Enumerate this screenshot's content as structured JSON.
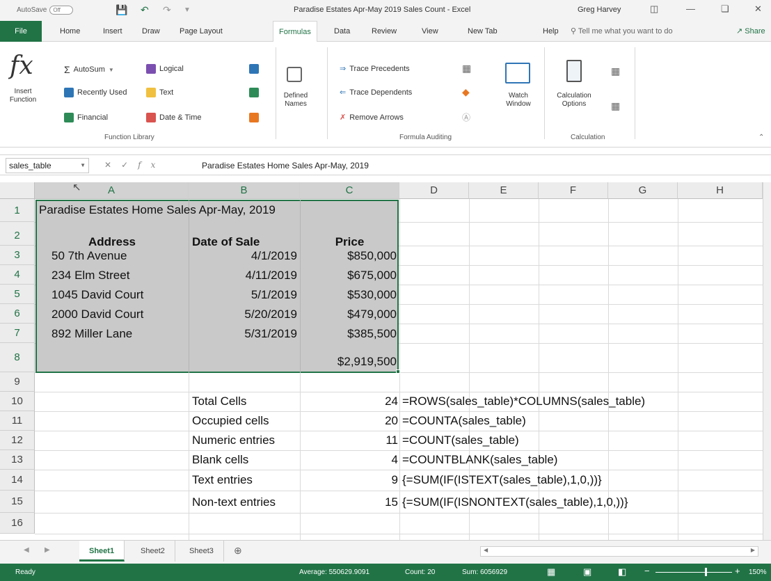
{
  "titlebar": {
    "autosave_label": "AutoSave",
    "autosave_state": "Off",
    "title": "Paradise Estates Apr-May 2019 Sales Count  -  Excel",
    "user": "Greg Harvey"
  },
  "tabs": [
    "File",
    "Home",
    "Insert",
    "Draw",
    "Page Layout",
    "Formulas",
    "Data",
    "Review",
    "View",
    "New Tab",
    "Help"
  ],
  "active_tab": "Formulas",
  "tell_me": "Tell me what you want to do",
  "share": "Share",
  "ribbon": {
    "insert_function": "Insert\nFunction",
    "autosum": "AutoSum",
    "recently_used": "Recently Used",
    "financial": "Financial",
    "logical": "Logical",
    "text": "Text",
    "date_time": "Date & Time",
    "defined_names": "Defined\nNames",
    "trace_precedents": "Trace Precedents",
    "trace_dependents": "Trace Dependents",
    "remove_arrows": "Remove Arrows",
    "watch_window": "Watch\nWindow",
    "calc_options": "Calculation\nOptions",
    "group_function_library": "Function Library",
    "group_formula_auditing": "Formula Auditing",
    "group_calculation": "Calculation"
  },
  "formula_bar": {
    "name_box": "sales_table",
    "content": "Paradise Estates Home Sales Apr-May, 2019"
  },
  "columns": [
    "A",
    "B",
    "C",
    "D",
    "E",
    "F",
    "G",
    "H"
  ],
  "rows": [
    "1",
    "2",
    "3",
    "4",
    "5",
    "6",
    "7",
    "8",
    "9",
    "10",
    "11",
    "12",
    "13",
    "14",
    "15",
    "16"
  ],
  "sheet": {
    "title": "Paradise Estates Home Sales Apr-May, 2019",
    "headers": [
      "Address",
      "Date of Sale",
      "Price"
    ],
    "data": [
      [
        "50 7th Avenue",
        "4/1/2019",
        "$850,000"
      ],
      [
        "234 Elm Street",
        "4/11/2019",
        "$675,000"
      ],
      [
        "1045 David Court",
        "5/1/2019",
        "$530,000"
      ],
      [
        "2000 David Court",
        "5/20/2019",
        "$479,000"
      ],
      [
        "892 Miller Lane",
        "5/31/2019",
        "$385,500"
      ]
    ],
    "total": "$2,919,500",
    "stats": [
      {
        "label": "Total Cells",
        "value": "24",
        "formula": "=ROWS(sales_table)*COLUMNS(sales_table)"
      },
      {
        "label": "Occupied cells",
        "value": "20",
        "formula": "=COUNTA(sales_table)"
      },
      {
        "label": "Numeric entries",
        "value": "11",
        "formula": "=COUNT(sales_table)"
      },
      {
        "label": "Blank cells",
        "value": "4",
        "formula": "=COUNTBLANK(sales_table)"
      },
      {
        "label": "Text entries",
        "value": "9",
        "formula": "{=SUM(IF(ISTEXT(sales_table),1,0,))}"
      },
      {
        "label": "Non-text entries",
        "value": "15",
        "formula": "{=SUM(IF(ISNONTEXT(sales_table),1,0,))}"
      }
    ]
  },
  "sheet_tabs": [
    "Sheet1",
    "Sheet2",
    "Sheet3"
  ],
  "status": {
    "mode": "Ready",
    "average": "Average: 550629.9091",
    "count": "Count: 20",
    "sum": "Sum: 6056929",
    "zoom": "150%"
  },
  "colors": {
    "accent": "#217346",
    "selection": "#c9c9c9"
  }
}
